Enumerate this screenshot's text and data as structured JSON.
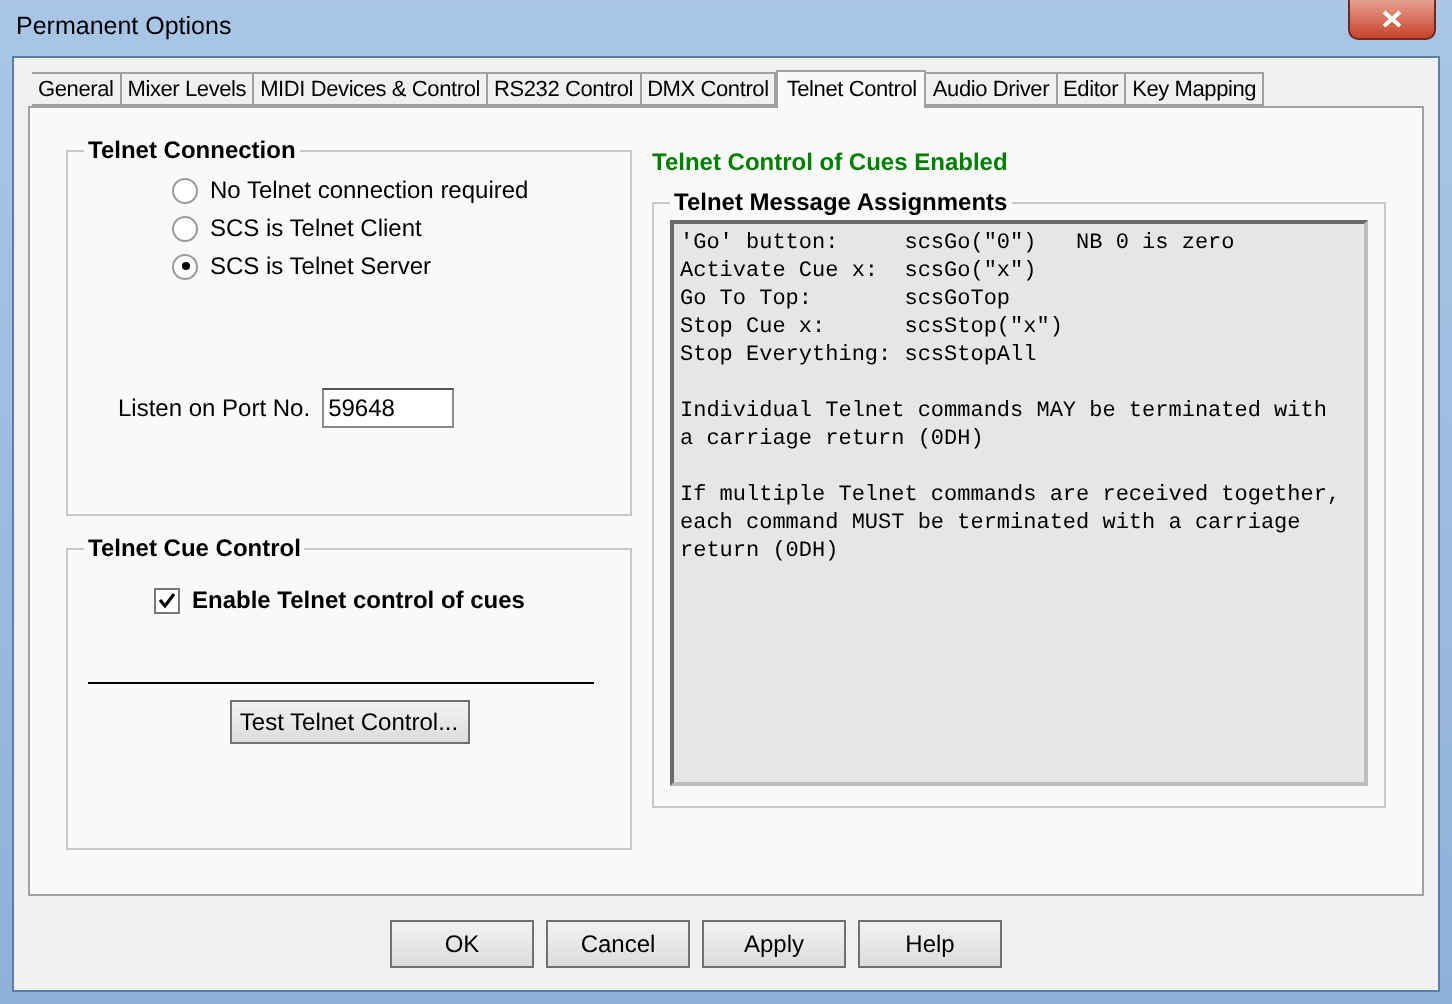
{
  "window": {
    "title": "Permanent Options"
  },
  "tabs": [
    {
      "label": "General",
      "selected": false
    },
    {
      "label": "Mixer Levels",
      "selected": false
    },
    {
      "label": "MIDI Devices & Control",
      "selected": false
    },
    {
      "label": "RS232 Control",
      "selected": false
    },
    {
      "label": "DMX Control",
      "selected": false
    },
    {
      "label": "Telnet Control",
      "selected": true
    },
    {
      "label": "Audio Driver",
      "selected": false
    },
    {
      "label": "Editor",
      "selected": false
    },
    {
      "label": "Key Mapping",
      "selected": false
    }
  ],
  "telnet_connection": {
    "title": "Telnet Connection",
    "options": [
      {
        "label": "No Telnet connection required",
        "selected": false
      },
      {
        "label": "SCS is Telnet Client",
        "selected": false
      },
      {
        "label": "SCS is Telnet Server",
        "selected": true
      }
    ],
    "port_label": "Listen on Port No.",
    "port_value": "59648"
  },
  "telnet_cue_control": {
    "title": "Telnet Cue Control",
    "checkbox": {
      "label": "Enable Telnet control of cues",
      "checked": true
    },
    "test_button": "Test Telnet Control..."
  },
  "status": "Telnet Control of Cues Enabled",
  "assignments": {
    "title": "Telnet Message Assignments",
    "paragraphs": [
      [
        "'Go' button:     scsGo(\"0\")   NB 0 is zero",
        "Activate Cue x:  scsGo(\"x\")",
        "Go To Top:       scsGoTop",
        "Stop Cue x:      scsStop(\"x\")",
        "Stop Everything: scsStopAll"
      ],
      [
        "Individual Telnet commands MAY be terminated with",
        "a carriage return (0DH)"
      ],
      [
        "If multiple Telnet commands are received together,",
        "each command MUST be terminated with a carriage",
        "return (0DH)"
      ]
    ]
  },
  "buttons": [
    "OK",
    "Cancel",
    "Apply",
    "Help"
  ]
}
